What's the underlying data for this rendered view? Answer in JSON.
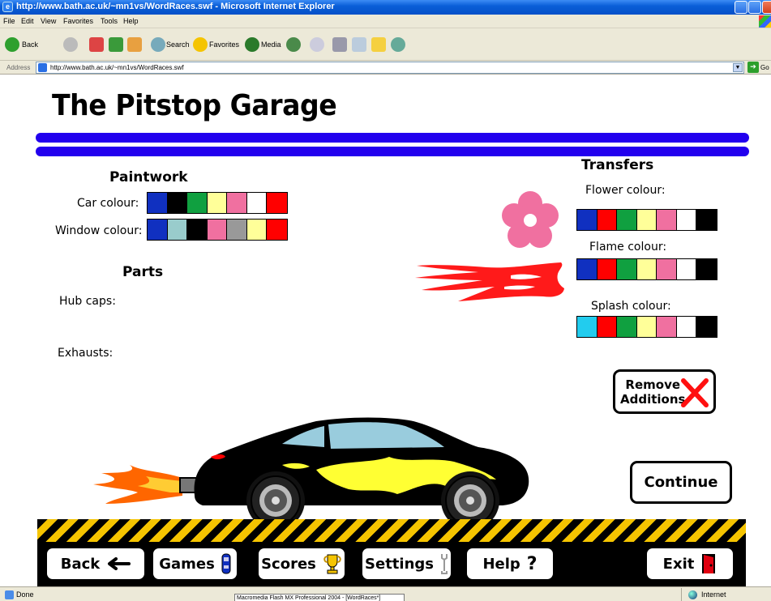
{
  "browser": {
    "title": "http://www.bath.ac.uk/~mn1vs/WordRaces.swf - Microsoft Internet Explorer",
    "menu": [
      "File",
      "Edit",
      "View",
      "Favorites",
      "Tools",
      "Help"
    ],
    "toolbar": {
      "back": "Back",
      "search": "Search",
      "favorites": "Favorites",
      "media": "Media"
    },
    "address_label": "Address",
    "address_value": "http://www.bath.ac.uk/~mn1vs/WordRaces.swf",
    "go_label": "Go"
  },
  "status": {
    "text": "Done",
    "zone": "Internet",
    "taskbar_tip": "Macromedia Flash MX Professional 2004 - [WordRaces*]"
  },
  "game": {
    "title": "The Pitstop Garage",
    "paintwork": {
      "heading": "Paintwork",
      "car_label": "Car colour:",
      "car_colours": [
        "#1030c0",
        "#000000",
        "#10a040",
        "#ffff99",
        "#f070a0",
        "#ffffff",
        "#ff0000"
      ],
      "window_label": "Window colour:",
      "window_colours": [
        "#1030c0",
        "#99cccc",
        "#000000",
        "#f070a0",
        "#999999",
        "#ffff99",
        "#ff0000"
      ]
    },
    "parts": {
      "heading": "Parts",
      "hub_caps_label": "Hub caps:",
      "exhausts_label": "Exhausts:"
    },
    "transfers": {
      "heading": "Transfers",
      "flower_label": "Flower colour:",
      "flower_colours": [
        "#1030c0",
        "#ff0000",
        "#10a040",
        "#ffff99",
        "#f070a0",
        "#ffffff",
        "#000000"
      ],
      "flame_label": "Flame colour:",
      "flame_colours": [
        "#1030c0",
        "#ff0000",
        "#10a040",
        "#ffff99",
        "#f070a0",
        "#ffffff",
        "#000000"
      ],
      "splash_label": "Splash colour:",
      "splash_colours": [
        "#22ccee",
        "#ff0000",
        "#10a040",
        "#ffff99",
        "#f070a0",
        "#ffffff",
        "#000000"
      ]
    },
    "remove_line1": "Remove",
    "remove_line2": "Additions",
    "continue_label": "Continue",
    "nav": {
      "back": "Back",
      "games": "Games",
      "scores": "Scores",
      "settings": "Settings",
      "help": "Help",
      "help_symbol": "?",
      "exit": "Exit"
    },
    "colors": {
      "stripe": "#2200ee",
      "hazard_yellow": "#f5c400",
      "flower": "#f070a0",
      "flame": "#ff1a1a",
      "exhaust_flame": "#ff6600"
    }
  }
}
